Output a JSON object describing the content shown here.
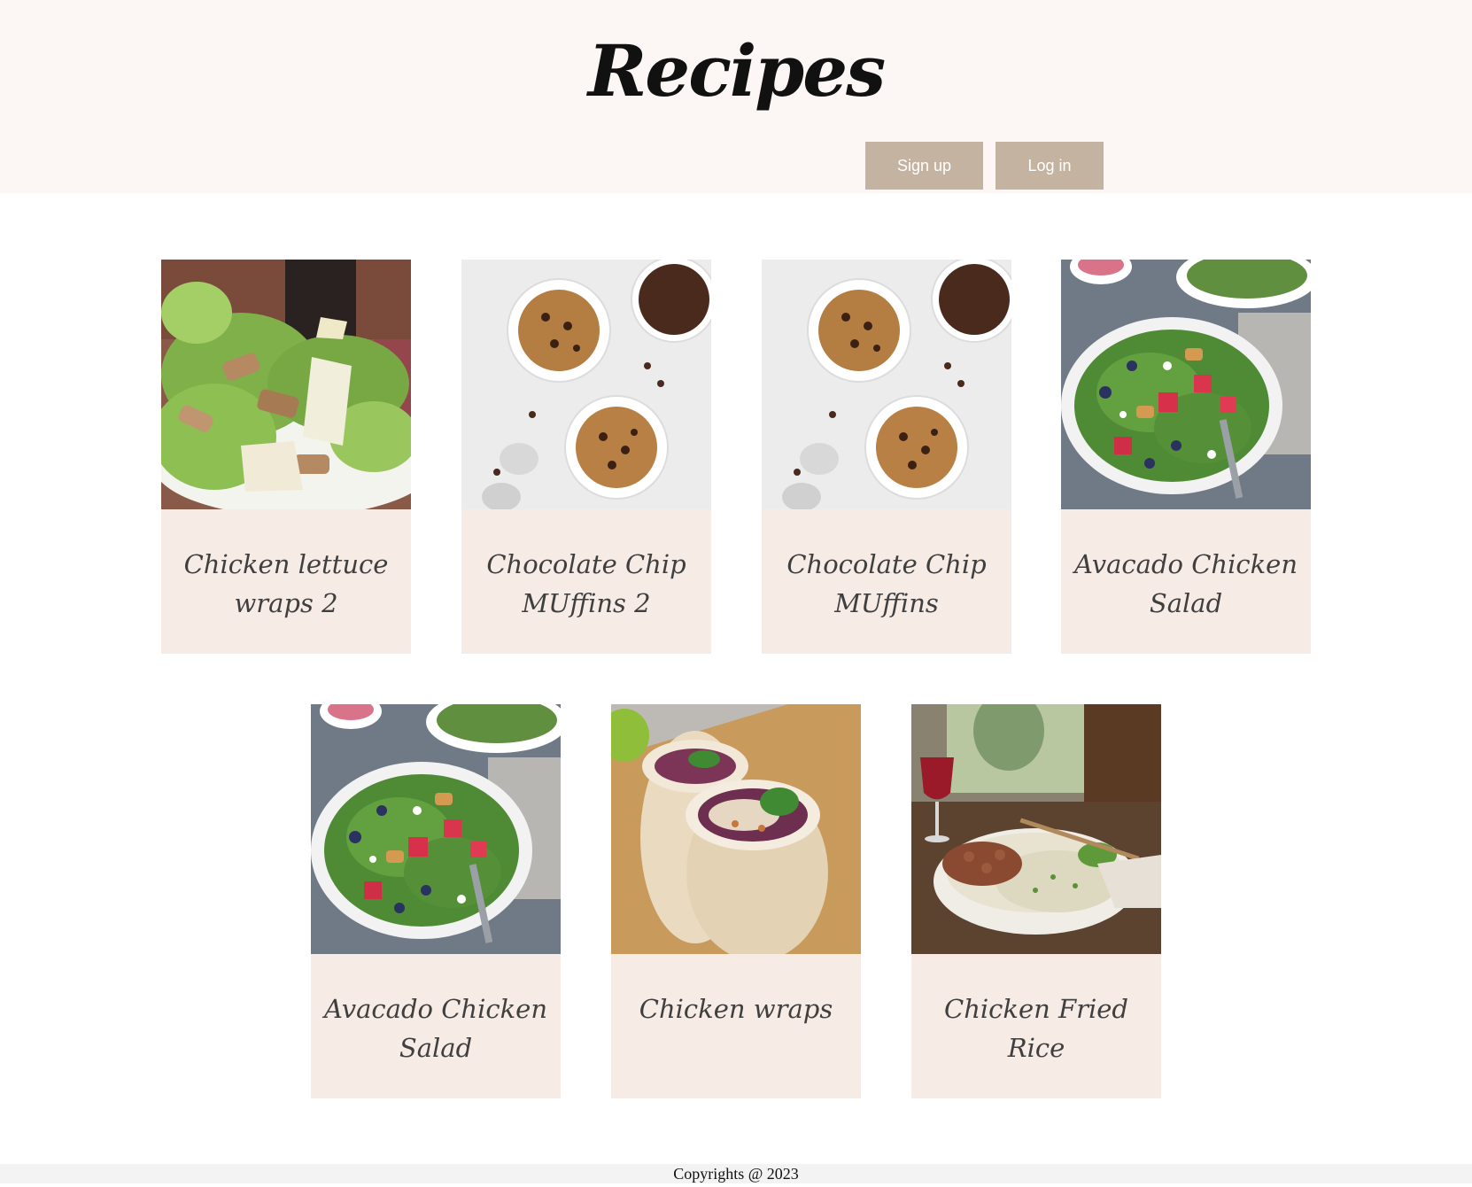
{
  "header": {
    "title": "Recipes",
    "signup_label": "Sign up",
    "login_label": "Log in",
    "background_color": "#fcf6f5",
    "button_color": "#c4b3a0"
  },
  "recipes": [
    {
      "title": "Chicken lettuce wraps 2",
      "image": "chicken-caesar-salad"
    },
    {
      "title": "Chocolate Chip MUffins 2",
      "image": "chocolate-chip-muffins"
    },
    {
      "title": "Chocolate Chip MUffins",
      "image": "chocolate-chip-muffins"
    },
    {
      "title": "Avacado Chicken Salad",
      "image": "chicken-berry-salad-bowl"
    },
    {
      "title": "Avacado Chicken Salad",
      "image": "chicken-berry-salad-bowl"
    },
    {
      "title": "Chicken wraps",
      "image": "chicken-wrap-halves"
    },
    {
      "title": "Chicken Fried Rice",
      "image": "fried-rice-bowl"
    }
  ],
  "card_caption_color": "#f7ebe6",
  "footer": {
    "text": "Copyrights @ 2023"
  }
}
